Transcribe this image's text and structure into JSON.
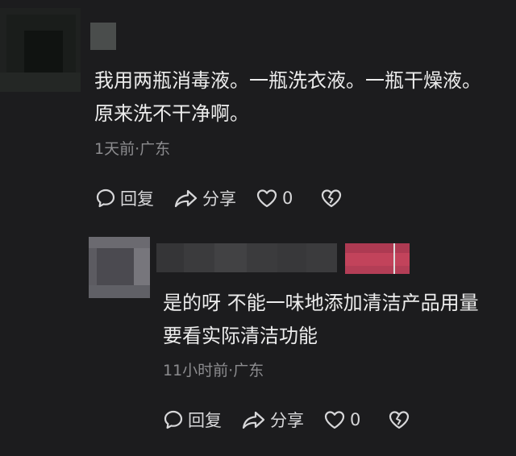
{
  "comments": [
    {
      "text": "我用两瓶消毒液。一瓶洗衣液。一瓶干燥液。原来洗不干净啊。",
      "meta": "1天前·广东",
      "reply_label": "回复",
      "share_label": "分享",
      "likes": "0"
    },
    {
      "text": "是的呀 不能一味地添加清洁产品用量 要看实际清洁功能",
      "meta": "11小时前·广东",
      "reply_label": "回复",
      "share_label": "分享",
      "likes": "0"
    }
  ],
  "colors": {
    "background": "#1c1c1e",
    "badge": "#c2435b"
  },
  "icons": [
    "comment-icon",
    "share-arrow-icon",
    "heart-icon",
    "broken-heart-icon"
  ]
}
